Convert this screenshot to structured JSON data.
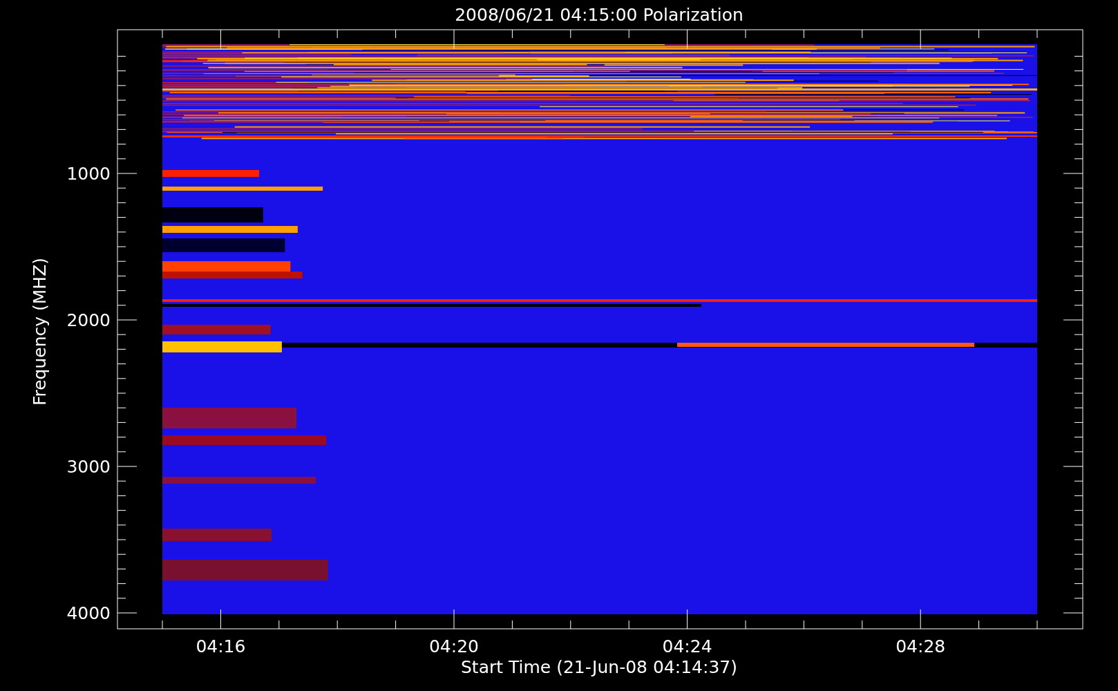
{
  "plot": {
    "title": "2008/06/21 04:15:00 Polarization",
    "ylabel": "Frequency (MHZ)",
    "xlabel": "Start Time (21-Jun-08 04:14:37)",
    "yticks": [
      "1000",
      "2000",
      "3000",
      "4000"
    ],
    "xticks": [
      "04:16",
      "04:20",
      "04:24",
      "04:28"
    ]
  }
}
